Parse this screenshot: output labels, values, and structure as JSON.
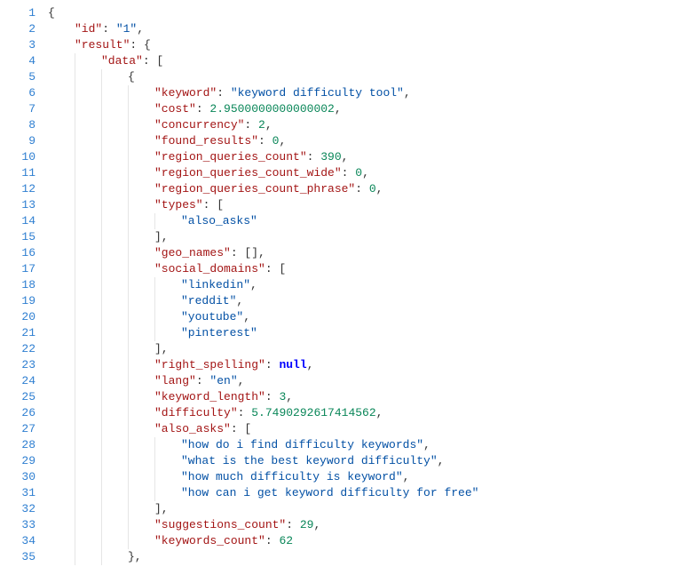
{
  "line_count": 35,
  "tokens": [
    [
      [
        "punc",
        "{"
      ]
    ],
    [
      [
        "key",
        "\"id\""
      ],
      [
        "punc",
        ": "
      ],
      [
        "str",
        "\"1\""
      ],
      [
        "punc",
        ","
      ]
    ],
    [
      [
        "key",
        "\"result\""
      ],
      [
        "punc",
        ": {"
      ]
    ],
    [
      [
        "key",
        "\"data\""
      ],
      [
        "punc",
        ": ["
      ]
    ],
    [
      [
        "punc",
        "{"
      ]
    ],
    [
      [
        "key",
        "\"keyword\""
      ],
      [
        "punc",
        ": "
      ],
      [
        "str",
        "\"keyword difficulty tool\""
      ],
      [
        "punc",
        ","
      ]
    ],
    [
      [
        "key",
        "\"cost\""
      ],
      [
        "punc",
        ": "
      ],
      [
        "num",
        "2.9500000000000002"
      ],
      [
        "punc",
        ","
      ]
    ],
    [
      [
        "key",
        "\"concurrency\""
      ],
      [
        "punc",
        ": "
      ],
      [
        "num",
        "2"
      ],
      [
        "punc",
        ","
      ]
    ],
    [
      [
        "key",
        "\"found_results\""
      ],
      [
        "punc",
        ": "
      ],
      [
        "num",
        "0"
      ],
      [
        "punc",
        ","
      ]
    ],
    [
      [
        "key",
        "\"region_queries_count\""
      ],
      [
        "punc",
        ": "
      ],
      [
        "num",
        "390"
      ],
      [
        "punc",
        ","
      ]
    ],
    [
      [
        "key",
        "\"region_queries_count_wide\""
      ],
      [
        "punc",
        ": "
      ],
      [
        "num",
        "0"
      ],
      [
        "punc",
        ","
      ]
    ],
    [
      [
        "key",
        "\"region_queries_count_phrase\""
      ],
      [
        "punc",
        ": "
      ],
      [
        "num",
        "0"
      ],
      [
        "punc",
        ","
      ]
    ],
    [
      [
        "key",
        "\"types\""
      ],
      [
        "punc",
        ": ["
      ]
    ],
    [
      [
        "str",
        "\"also_asks\""
      ]
    ],
    [
      [
        "punc",
        "],"
      ]
    ],
    [
      [
        "key",
        "\"geo_names\""
      ],
      [
        "punc",
        ": [],"
      ]
    ],
    [
      [
        "key",
        "\"social_domains\""
      ],
      [
        "punc",
        ": ["
      ]
    ],
    [
      [
        "str",
        "\"linkedin\""
      ],
      [
        "punc",
        ","
      ]
    ],
    [
      [
        "str",
        "\"reddit\""
      ],
      [
        "punc",
        ","
      ]
    ],
    [
      [
        "str",
        "\"youtube\""
      ],
      [
        "punc",
        ","
      ]
    ],
    [
      [
        "str",
        "\"pinterest\""
      ]
    ],
    [
      [
        "punc",
        "],"
      ]
    ],
    [
      [
        "key",
        "\"right_spelling\""
      ],
      [
        "punc",
        ": "
      ],
      [
        "kw",
        "null"
      ],
      [
        "punc",
        ","
      ]
    ],
    [
      [
        "key",
        "\"lang\""
      ],
      [
        "punc",
        ": "
      ],
      [
        "str",
        "\"en\""
      ],
      [
        "punc",
        ","
      ]
    ],
    [
      [
        "key",
        "\"keyword_length\""
      ],
      [
        "punc",
        ": "
      ],
      [
        "num",
        "3"
      ],
      [
        "punc",
        ","
      ]
    ],
    [
      [
        "key",
        "\"difficulty\""
      ],
      [
        "punc",
        ": "
      ],
      [
        "num",
        "5.7490292617414562"
      ],
      [
        "punc",
        ","
      ]
    ],
    [
      [
        "key",
        "\"also_asks\""
      ],
      [
        "punc",
        ": ["
      ]
    ],
    [
      [
        "str",
        "\"how do i find difficulty keywords\""
      ],
      [
        "punc",
        ","
      ]
    ],
    [
      [
        "str",
        "\"what is the best keyword difficulty\""
      ],
      [
        "punc",
        ","
      ]
    ],
    [
      [
        "str",
        "\"how much difficulty is keyword\""
      ],
      [
        "punc",
        ","
      ]
    ],
    [
      [
        "str",
        "\"how can i get keyword difficulty for free\""
      ]
    ],
    [
      [
        "punc",
        "],"
      ]
    ],
    [
      [
        "key",
        "\"suggestions_count\""
      ],
      [
        "punc",
        ": "
      ],
      [
        "num",
        "29"
      ],
      [
        "punc",
        ","
      ]
    ],
    [
      [
        "key",
        "\"keywords_count\""
      ],
      [
        "punc",
        ": "
      ],
      [
        "num",
        "62"
      ]
    ],
    [
      [
        "punc",
        "},"
      ]
    ]
  ],
  "indents": [
    0,
    1,
    1,
    2,
    3,
    4,
    4,
    4,
    4,
    4,
    4,
    4,
    4,
    5,
    4,
    4,
    4,
    5,
    5,
    5,
    5,
    4,
    4,
    4,
    4,
    4,
    4,
    5,
    5,
    5,
    5,
    4,
    4,
    4,
    3
  ]
}
